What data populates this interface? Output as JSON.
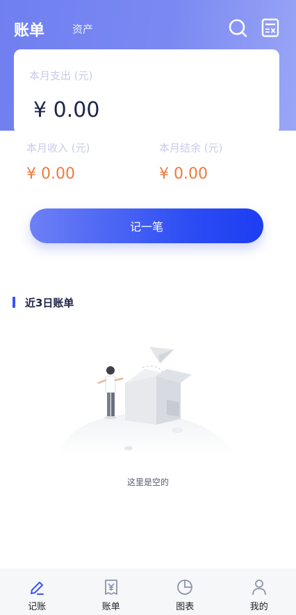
{
  "header": {
    "title": "账单",
    "subtitle": "资产",
    "search_icon": "search-icon",
    "calculator_icon": "calculator-icon"
  },
  "summary": {
    "expense_label": "本月支出 (元)",
    "expense_value": "¥ 0.00",
    "income_label": "本月收入 (元)",
    "income_value": "¥ 0.00",
    "balance_label": "本月结余 (元)",
    "balance_value": "¥ 0.00"
  },
  "record_button": {
    "label": "记一笔"
  },
  "recent": {
    "title": "近3日账单",
    "empty_text": "这里是空的"
  },
  "tabbar": {
    "items": [
      {
        "label": "记账",
        "icon": "pencil-icon",
        "active": true
      },
      {
        "label": "账单",
        "icon": "receipt-icon",
        "active": false
      },
      {
        "label": "图表",
        "icon": "pie-chart-icon",
        "active": false
      },
      {
        "label": "我的",
        "icon": "person-icon",
        "active": false
      }
    ]
  },
  "colors": {
    "accent": "#3b55f0",
    "header_gradient_start": "#6f7ff0",
    "header_gradient_end": "#9aa6f6",
    "amount_orange": "#f07a3c",
    "label_light": "#c7cbe8",
    "text_dark": "#1e244a"
  }
}
